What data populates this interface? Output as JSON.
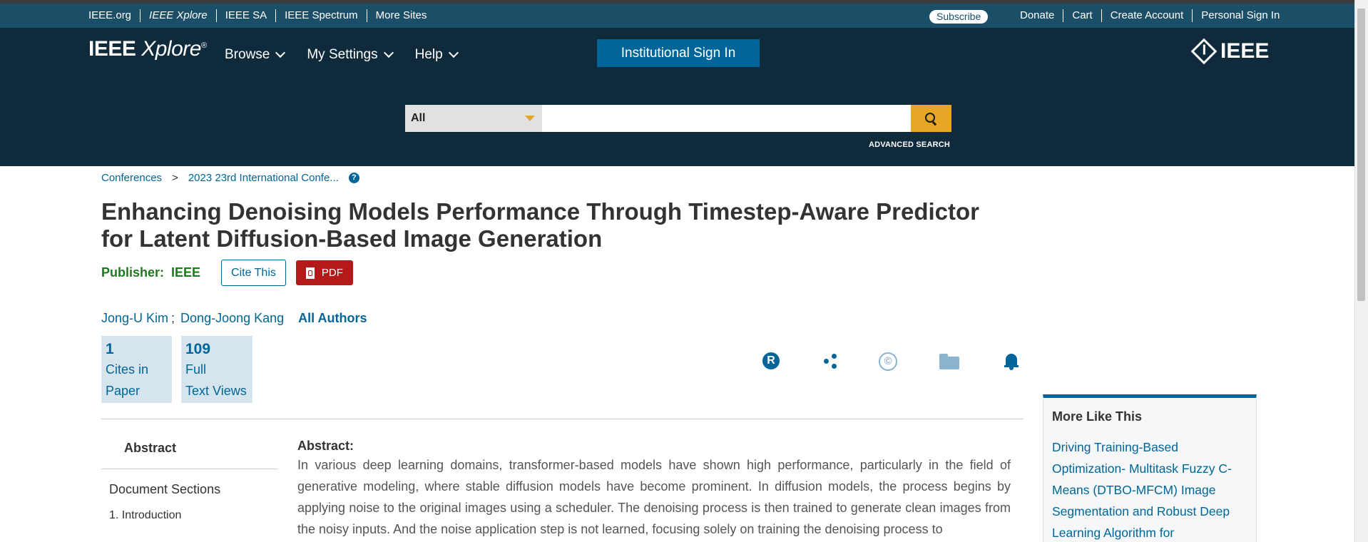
{
  "meta_links": [
    "IEEE.org",
    "IEEE Xplore",
    "IEEE SA",
    "IEEE Spectrum",
    "More Sites"
  ],
  "subscribe": "Subscribe",
  "account_links": [
    "Donate",
    "Cart",
    "Create Account",
    "Personal Sign In"
  ],
  "brand": {
    "name_part1": "IEEE",
    "name_part2": "Xplore",
    "reg": "®"
  },
  "nav": [
    "Browse",
    "My Settings",
    "Help"
  ],
  "institutional_signin": "Institutional Sign In",
  "ieee_logo_text": "IEEE",
  "search": {
    "scope": "All",
    "value": "",
    "advanced": "ADVANCED SEARCH"
  },
  "breadcrumb": {
    "first": "Conferences",
    "sep": ">",
    "second": "2023 23rd International Confe...",
    "help": "?"
  },
  "article": {
    "title": "Enhancing Denoising Models Performance Through Timestep-Aware Predictor for Latent Diffusion-Based Image Generation",
    "publisher_label": "Publisher:",
    "publisher": "IEEE",
    "cite": "Cite This",
    "pdf": "PDF"
  },
  "authors": {
    "list": [
      "Jong-U Kim",
      "Dong-Joong Kang"
    ],
    "semi": ";",
    "all": "All Authors"
  },
  "metrics": [
    {
      "value": "1",
      "line1": "Cites in",
      "line2": "Paper"
    },
    {
      "value": "109",
      "line1": "Full",
      "line2": "Text Views"
    }
  ],
  "icons": {
    "rights": "R",
    "copyright": "©"
  },
  "sidenav": {
    "active": "Abstract",
    "heading": "Document Sections",
    "items": [
      "1.  Introduction"
    ]
  },
  "abstract": {
    "heading": "Abstract:",
    "text": "In various deep learning domains, transformer-based models have shown high performance, particularly in the field of generative modeling, where stable diffusion models have become prominent. In diffusion models, the process begins by applying noise to the original images using a scheduler. The denoising process is then trained to generate clean images from the noisy inputs. And the noise application step is not learned, focusing solely on training the denoising process to"
  },
  "more_like_this": {
    "heading": "More Like This",
    "first": "Driving Training-Based Optimization- Multitask Fuzzy C-Means (DTBO-MFCM) Image Segmentation and Robust Deep Learning Algorithm for"
  }
}
